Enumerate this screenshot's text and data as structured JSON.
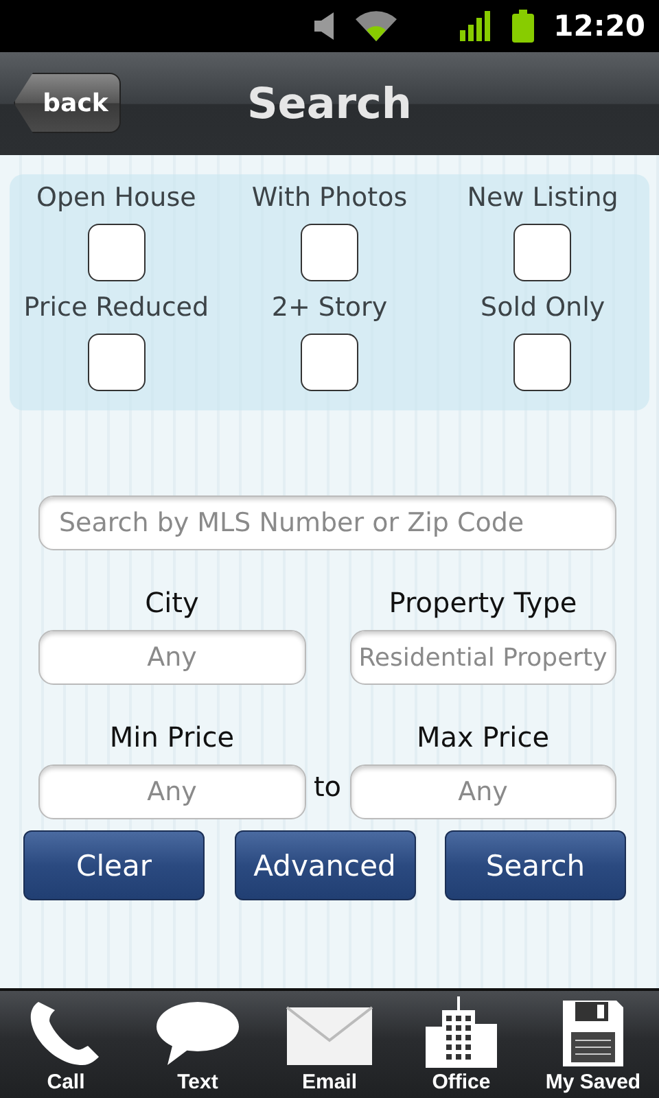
{
  "status_bar": {
    "time": "12:20"
  },
  "header": {
    "back": "back",
    "title": "Search"
  },
  "filters": [
    {
      "label": "Open House",
      "checked": false
    },
    {
      "label": "With Photos",
      "checked": false
    },
    {
      "label": "New Listing",
      "checked": false
    },
    {
      "label": "Price Reduced",
      "checked": false
    },
    {
      "label": "2+ Story",
      "checked": false
    },
    {
      "label": "Sold Only",
      "checked": false
    }
  ],
  "search": {
    "placeholder": "Search by MLS Number or Zip Code"
  },
  "city": {
    "label": "City",
    "placeholder": "Any"
  },
  "property_type": {
    "label": "Property Type",
    "placeholder": "Residential Property"
  },
  "min_price": {
    "label": "Min Price",
    "placeholder": "Any"
  },
  "range_separator": "to",
  "max_price": {
    "label": "Max Price",
    "placeholder": "Any"
  },
  "buttons": [
    "Clear",
    "Advanced",
    "Search"
  ],
  "tab_bar": [
    {
      "kind": "call",
      "label": "Call"
    },
    {
      "kind": "text",
      "label": "Text"
    },
    {
      "kind": "email",
      "label": "Email"
    },
    {
      "kind": "office",
      "label": "Office"
    },
    {
      "kind": "saved",
      "label": "My Saved"
    }
  ]
}
